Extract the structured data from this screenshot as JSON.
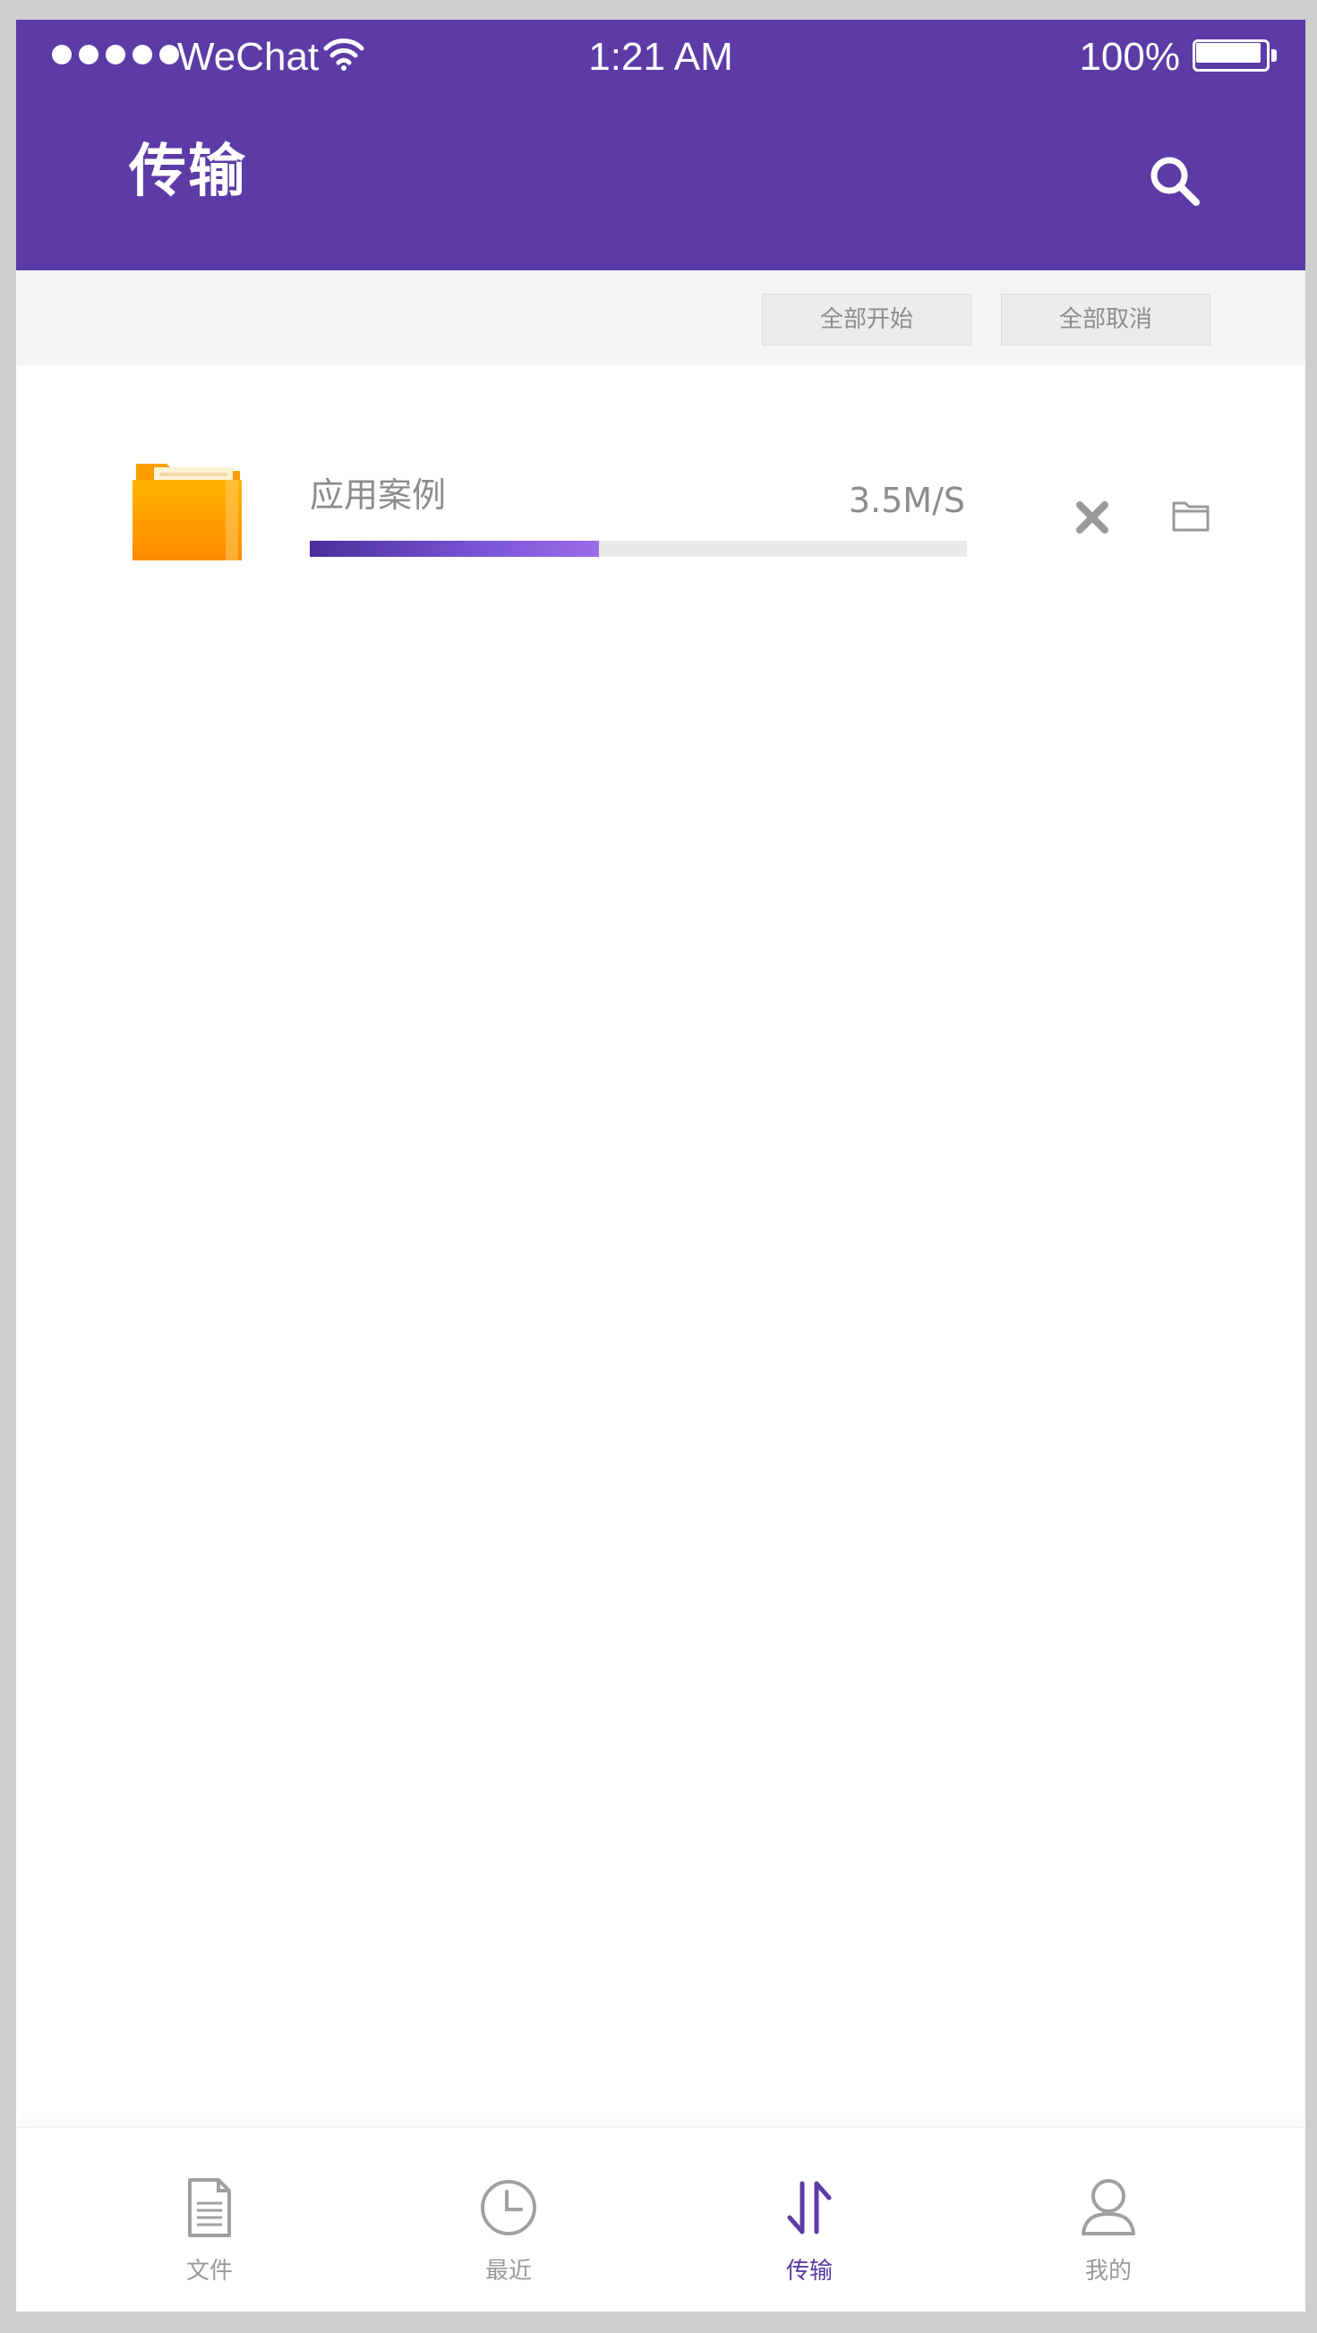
{
  "status_bar": {
    "carrier": "WeChat",
    "time": "1:21 AM",
    "battery": "100%"
  },
  "header": {
    "title": "传输",
    "search_icon": "search-icon"
  },
  "actions": {
    "start_all": "全部开始",
    "cancel_all": "全部取消"
  },
  "transfer": {
    "name": "应用案例",
    "speed": "3.5M/S",
    "progress": 0.44,
    "icon": "folder-icon",
    "cancel_icon": "close-icon",
    "open_icon": "folder-outline-icon"
  },
  "tabs": [
    {
      "label": "文件",
      "icon": "document-icon",
      "active": false
    },
    {
      "label": "最近",
      "icon": "clock-icon",
      "active": false
    },
    {
      "label": "传输",
      "icon": "transfer-arrows-icon",
      "active": true
    },
    {
      "label": "我的",
      "icon": "user-icon",
      "active": false
    }
  ],
  "colors": {
    "primary": "#5c3ba6",
    "muted": "#9a9a9a"
  }
}
